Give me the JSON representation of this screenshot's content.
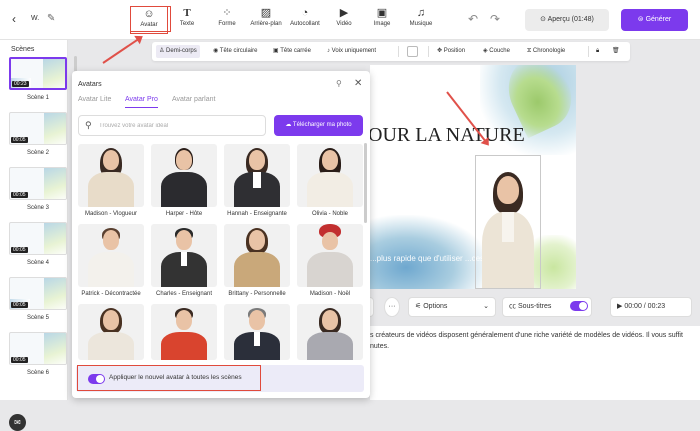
{
  "topbar": {
    "project_name": "W.",
    "tools": [
      {
        "label": "Avatar",
        "icon": "avatar-icon",
        "glyph": "☺"
      },
      {
        "label": "Texte",
        "icon": "text-icon",
        "glyph": "T"
      },
      {
        "label": "Forme",
        "icon": "shapes-icon",
        "glyph": "⁘"
      },
      {
        "label": "Arrière-plan",
        "icon": "background-icon",
        "glyph": "▨"
      },
      {
        "label": "Autocollant",
        "icon": "sticker-icon",
        "glyph": "◔"
      },
      {
        "label": "Vidéo",
        "icon": "video-icon",
        "glyph": "▶"
      },
      {
        "label": "Image",
        "icon": "image-icon",
        "glyph": "▣"
      },
      {
        "label": "Musique",
        "icon": "music-icon",
        "glyph": "♫"
      }
    ],
    "preview_label": "Aperçu (01:48)",
    "generate_label": "Générer"
  },
  "scenes": {
    "title": "Scènes",
    "items": [
      {
        "label": "Scène 1",
        "duration": "00:23"
      },
      {
        "label": "Scène 2",
        "duration": "00:05"
      },
      {
        "label": "Scène 3",
        "duration": "00:05"
      },
      {
        "label": "Scène 4",
        "duration": "00:05"
      },
      {
        "label": "Scène 5",
        "duration": "00:05"
      },
      {
        "label": "Scène 6",
        "duration": "00:05"
      }
    ]
  },
  "subtoolbar": {
    "half_body": "Demi-corps",
    "circle_head": "Tête circulaire",
    "square_head": "Tête carrée",
    "voice_only": "Voix uniquement",
    "position": "Position",
    "layer": "Couche",
    "timeline": "Chronologie"
  },
  "canvas": {
    "title": "OUR LA NATURE",
    "subtitle": "...plus rapide que d'utiliser ...ces..."
  },
  "controls": {
    "options": "Options",
    "subtitles": "Sous-titres",
    "time": "00:00 / 00:23"
  },
  "script": {
    "line1": "s créateurs de vidéos disposent généralement d'une riche variété de modèles de vidéos. Il vous suffit",
    "line2": "nutes."
  },
  "panel": {
    "title": "Avatars",
    "tabs": [
      "Avatar Lite",
      "Avatar Pro",
      "Avatar parlant"
    ],
    "search_placeholder": "Trouvez votre avatar idéal",
    "upload_label": "Télécharger ma photo",
    "avatars": [
      {
        "name": "Madison - Vlogueur",
        "hair": "#3a2a22",
        "outfit": "#e8dcc9"
      },
      {
        "name": "Harper - Hôte",
        "hair": "#2a1d18",
        "outfit": "#2b2b2f"
      },
      {
        "name": "Hannah - Enseignante",
        "hair": "#3a2a22",
        "outfit": "#2f2f33"
      },
      {
        "name": "Olivia - Noble",
        "hair": "#2a1d18",
        "outfit": "#f2ede4"
      },
      {
        "name": "Patrick - Décontractée",
        "hair": "#5a4030",
        "outfit": "#f3f1ec"
      },
      {
        "name": "Charles - Enseignant",
        "hair": "#2a2a2a",
        "outfit": "#333"
      },
      {
        "name": "Brittany - Personnelle",
        "hair": "#4a3222",
        "outfit": "#c9a87a"
      },
      {
        "name": "Madison - Noël",
        "hair": "#c22f2f",
        "outfit": "#d8d4d0"
      },
      {
        "name": "",
        "hair": "#4a3222",
        "outfit": "#ece6dc"
      },
      {
        "name": "",
        "hair": "#3a2a22",
        "outfit": "#d9442e"
      },
      {
        "name": "",
        "hair": "#7a7a7a",
        "outfit": "#2b2f3a"
      },
      {
        "name": "",
        "hair": "#3a2a22",
        "outfit": "#a9a9b0"
      }
    ],
    "apply_label": "Appliquer le nouvel avatar à toutes les scènes"
  },
  "colors": {
    "accent": "#7c3aed",
    "highlight": "#e04a3c"
  }
}
